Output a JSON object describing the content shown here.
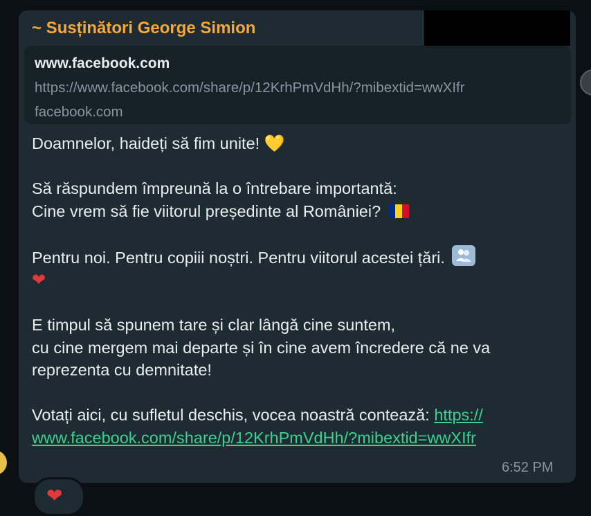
{
  "message": {
    "sender": "~ Susținători George Simion",
    "link_preview": {
      "title": "www.facebook.com",
      "url": "https://www.facebook.com/share/p/12KrhPmVdHh/?mibextid=wwXIfr",
      "domain": "facebook.com"
    },
    "lines": {
      "l1": "Doamnelor, haideți să fim unite! ",
      "l2": "Să răspundem împreună la o întrebare importantă:",
      "l3": "Cine vrem să fie viitorul președinte al României? ",
      "l4": "Pentru noi. Pentru copiii noștri. Pentru viitorul acestei țări. ",
      "l5": "E timpul să spunem tare și clar lângă cine suntem,",
      "l6": "cu cine mergem mai departe și în cine avem încredere că ne va",
      "l7": "reprezenta cu demnitate!",
      "l8_prefix": "Votați aici, cu sufletul deschis, vocea noastră contează: ",
      "l8_link_part1": "https://",
      "l9_link_part2": "www.facebook.com/share/p/12KrhPmVdHh/?mibextid=wwXIfr"
    },
    "emojis": {
      "yellow_heart": "💛",
      "red_heart": "❤"
    },
    "time": "6:52 PM",
    "reaction": "❤"
  },
  "colors": {
    "sender": "#f4a83a",
    "link": "#3fcf8e",
    "bubble": "#1f2b32",
    "flag_blue": "#002b7f",
    "flag_yellow": "#fcd116",
    "flag_red": "#ce1126"
  },
  "icons": {
    "flag": "romania-flag-icon",
    "people": "busts-in-silhouette-icon"
  }
}
